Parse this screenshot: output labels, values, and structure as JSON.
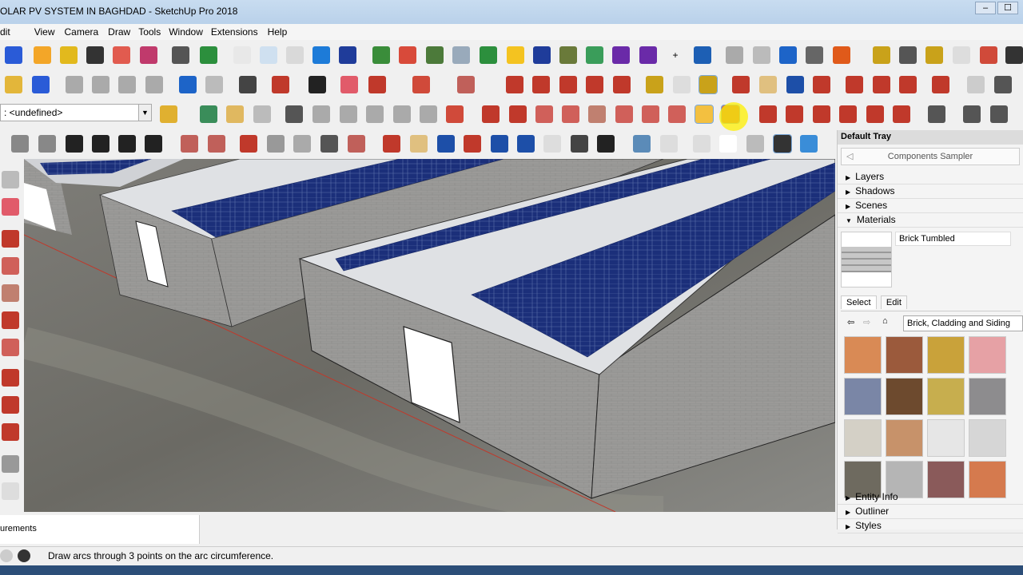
{
  "window": {
    "title": "OLAR PV SYSTEM IN BAGHDAD - SketchUp Pro 2018",
    "minimize": "–",
    "maximize": "☐",
    "close": "✕"
  },
  "menu": [
    "dit",
    "View",
    "Camera",
    "Draw",
    "Tools",
    "Window",
    "Extensions",
    "Help"
  ],
  "layer_selector": {
    "value": ": <undefined>"
  },
  "tray": {
    "title": "Default Tray",
    "sampler": "Components Sampler",
    "sections_top": [
      "Layers",
      "Shadows",
      "Scenes"
    ],
    "materials_label": "Materials",
    "material_name": "Brick Tumbled",
    "tabs": {
      "select": "Select",
      "edit": "Edit"
    },
    "library": "Brick, Cladding and Siding",
    "sections_bottom": [
      "Entity Info",
      "Outliner",
      "Styles"
    ],
    "swatch_colors": [
      "#d98a55",
      "#9b5a3c",
      "#c9a23a",
      "#e6a1a5",
      "#7a86a6",
      "#6d4a2e",
      "#c7ae4e",
      "#8d8c8e",
      "#d4d0c6",
      "#c7926a",
      "#e6e6e6",
      "#d6d6d6",
      "#6e6a5f",
      "#b5b5b5",
      "#8a5a5a",
      "#d57a4e"
    ]
  },
  "measurements_label": "urements",
  "status": {
    "hint": "Draw arcs through 3 points on the arc circumference."
  }
}
